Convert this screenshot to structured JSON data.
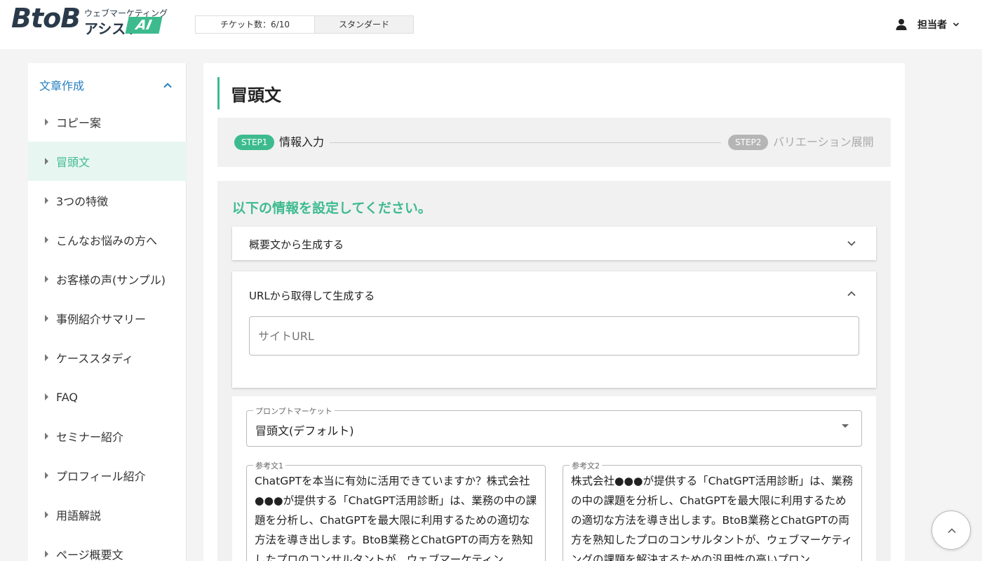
{
  "header": {
    "logo_main": "BtoB",
    "logo_sub1": "ウェブマーケティング",
    "logo_sub2": "アシスト",
    "logo_ai": "AI",
    "ticket_count": "チケット数：6/10",
    "plan": "スタンダード",
    "user_name": "担当者"
  },
  "sidebar": {
    "section_label": "文章作成",
    "items": [
      {
        "label": "コピー案"
      },
      {
        "label": "冒頭文"
      },
      {
        "label": "3つの特徴"
      },
      {
        "label": "こんなお悩みの方へ"
      },
      {
        "label": "お客様の声(サンプル)"
      },
      {
        "label": "事例紹介サマリー"
      },
      {
        "label": "ケーススタディ"
      },
      {
        "label": "FAQ"
      },
      {
        "label": "セミナー紹介"
      },
      {
        "label": "プロフィール紹介"
      },
      {
        "label": "用語解説"
      },
      {
        "label": "ページ概要文"
      }
    ],
    "active_index": 1
  },
  "main": {
    "page_title": "冒頭文",
    "step1_badge": "STEP1",
    "step1_label": "情報入力",
    "step2_badge": "STEP2",
    "step2_label": "バリエーション展開",
    "form_heading": "以下の情報を設定してください。",
    "accordion1_label": "概要文から生成する",
    "accordion2_label": "URLから取得して生成する",
    "url_placeholder": "サイトURL",
    "prompt_label": "プロンプトマーケット",
    "prompt_value": "冒頭文(デフォルト)",
    "ref1_label": "参考文1",
    "ref1_text": "ChatGPTを本当に有効に活用できていますか？株式会社●●●が提供する「ChatGPT活用診断」は、業務の中の課題を分析し、ChatGPTを最大限に利用するための適切な方法を導き出します。BtoB業務とChatGPTの両方を熟知したプロのコンサルタントが、ウェブマーケティン",
    "ref2_label": "参考文2",
    "ref2_text": "株式会社●●●が提供する「ChatGPT活用診断」は、業務の中の課題を分析し、ChatGPTを最大限に利用するための適切な方法を導き出します。BtoB業務とChatGPTの両方を熟知したプロのコンサルタントが、ウェブマーケティングの課題を解決するための汎用性の高いプロン"
  },
  "colors": {
    "accent": "#3dbb8f",
    "section_link": "#2680c2",
    "active_bg": "#e8f6f1"
  },
  "icons": [
    "user-icon",
    "chevron-down-icon",
    "chevron-up-icon",
    "caret-right-icon",
    "dropdown-caret-icon"
  ]
}
